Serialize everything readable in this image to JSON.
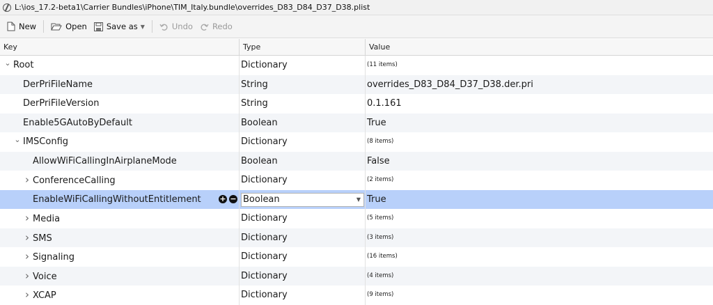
{
  "window": {
    "title": "L:\\ios_17.2-beta1\\Carrier Bundles\\iPhone\\TIM_Italy.bundle\\overrides_D83_D84_D37_D38.plist"
  },
  "toolbar": {
    "new_label": "New",
    "open_label": "Open",
    "save_as_label": "Save as",
    "undo_label": "Undo",
    "redo_label": "Redo"
  },
  "columns": {
    "key": "Key",
    "type": "Type",
    "value": "Value"
  },
  "rows": [
    {
      "key": "Root",
      "type": "Dictionary",
      "value": "(11 items)",
      "level": 0,
      "expander": "open",
      "small": true
    },
    {
      "key": "DerPriFileName",
      "type": "String",
      "value": "overrides_D83_D84_D37_D38.der.pri",
      "level": 1,
      "expander": "none",
      "small": false
    },
    {
      "key": "DerPriFileVersion",
      "type": "String",
      "value": "0.1.161",
      "level": 1,
      "expander": "none",
      "small": false
    },
    {
      "key": "Enable5GAutoByDefault",
      "type": "Boolean",
      "value": "True",
      "level": 1,
      "expander": "none",
      "small": false
    },
    {
      "key": "IMSConfig",
      "type": "Dictionary",
      "value": "(8 items)",
      "level": 1,
      "expander": "open",
      "small": true
    },
    {
      "key": "AllowWiFiCallingInAirplaneMode",
      "type": "Boolean",
      "value": "False",
      "level": 2,
      "expander": "none",
      "small": false
    },
    {
      "key": "ConferenceCalling",
      "type": "Dictionary",
      "value": "(2 items)",
      "level": 2,
      "expander": "closed",
      "small": true
    },
    {
      "key": "EnableWiFiCallingWithoutEntitlement",
      "type": "Boolean",
      "value": "True",
      "level": 2,
      "expander": "none",
      "small": false,
      "selected": true
    },
    {
      "key": "Media",
      "type": "Dictionary",
      "value": "(5 items)",
      "level": 2,
      "expander": "closed",
      "small": true
    },
    {
      "key": "SMS",
      "type": "Dictionary",
      "value": "(3 items)",
      "level": 2,
      "expander": "closed",
      "small": true
    },
    {
      "key": "Signaling",
      "type": "Dictionary",
      "value": "(16 items)",
      "level": 2,
      "expander": "closed",
      "small": true
    },
    {
      "key": "Voice",
      "type": "Dictionary",
      "value": "(4 items)",
      "level": 2,
      "expander": "closed",
      "small": true
    },
    {
      "key": "XCAP",
      "type": "Dictionary",
      "value": "(9 items)",
      "level": 2,
      "expander": "closed",
      "small": true
    }
  ],
  "icons": {
    "app": "plist-editor-app-icon",
    "new": "new-document-icon",
    "open": "folder-open-icon",
    "save": "floppy-disk-icon",
    "undo": "undo-icon",
    "redo": "redo-icon",
    "add": "plus-circle-icon",
    "remove": "minus-circle-icon"
  },
  "colors": {
    "selected_row": "#b8d0fa",
    "alt_row": "#f3f5f8",
    "header_bg": "#f7f7f7"
  }
}
